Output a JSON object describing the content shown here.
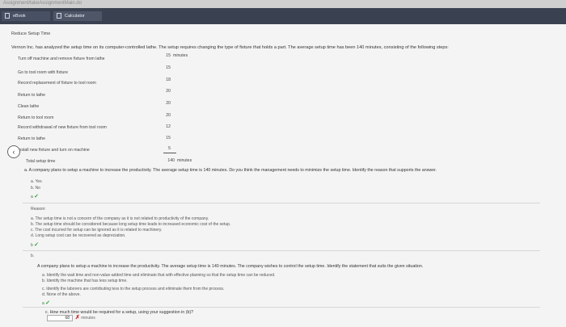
{
  "browser": {
    "url": "Assignment/takeAssignmentMain.do"
  },
  "tabs": [
    {
      "label": "eBook",
      "icon": "book-icon"
    },
    {
      "label": "Calculator",
      "icon": "calculator-icon"
    }
  ],
  "page": {
    "title": "Reduce Setup Time",
    "intro": "Vernon Inc. has analyzed the setup time on its computer-controlled lathe. The setup requires changing the type of fixture that holds a part. The average setup time has been 140 minutes, consisting of the following steps:",
    "steps": [
      {
        "label": "Turn off machine and remove fixture from lathe",
        "value": "15",
        "unit": "minutes"
      },
      {
        "label": "Go to tool room with fixture",
        "value": "15"
      },
      {
        "label": "Record replacement of fixture to tool room",
        "value": "18"
      },
      {
        "label": "Return to lathe",
        "value": "20"
      },
      {
        "label": "Clean lathe",
        "value": "20"
      },
      {
        "label": "Return to tool room",
        "value": "20"
      },
      {
        "label": "Record withdrawal of new fixture from tool room",
        "value": "12"
      },
      {
        "label": "Return to lathe",
        "value": "15"
      },
      {
        "label": "Install new fixture and turn on machine",
        "value": "5"
      }
    ],
    "total": {
      "label": "Total setup time",
      "value": "140",
      "unit": "minutes"
    }
  },
  "question_a": {
    "prompt": "a. A company plans to setup a machine to increase the productivity. The average setup time is 140 minutes. Do you think the management needs to minimize the setup time. Identify the reason that supports the answer.",
    "options": [
      "a. Yes",
      "b. No"
    ],
    "answer": "a",
    "reason_label": "Reason:",
    "reasons": [
      "a. The setup time is not a concern of the company as it is not related to productivity of the company.",
      "b. The setup time should be considered because long setup time leads to increased economic cost of the setup.",
      "c. The cost incurred for setup can be ignored as it is related to machinery.",
      "d. Long setup cost can be recovered as depreciation."
    ],
    "reason_answer": "b"
  },
  "question_b": {
    "label": "b.",
    "prompt": "A company plans to setup a machine to increase the productivity. The average setup time is 140 minutes. The company wishes to control the setup time. Identify the statement that suits the given situation.",
    "options": [
      "a. Identify the wait time and non-value-added time and eliminate that with effective planning so that the setup time can be reduced.",
      "b. Identify the machine that has less setup time.",
      "c. Identify the laborers are contributing less to the setup process and eliminate them from the process.",
      "d. None of the above."
    ],
    "answer": "a"
  },
  "question_c": {
    "prompt": "c. How much time would be required for a setup, using your suggestion in (b)?",
    "input_value": "68",
    "unit": "minutes"
  }
}
